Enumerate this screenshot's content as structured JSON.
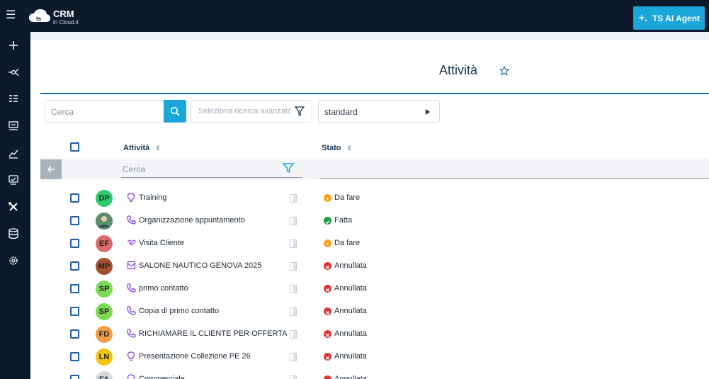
{
  "app": {
    "brand": "CRM",
    "brand_sub": "in Cloud.it",
    "agent_button": "TS AI Agent"
  },
  "page": {
    "title": "Attività"
  },
  "search": {
    "placeholder": "Cerca",
    "advanced_placeholder": "Seleziona ricerca avanzata",
    "view": "standard"
  },
  "table": {
    "headers": {
      "activity": "Attività",
      "status": "Stato"
    },
    "column_search": "Cerca",
    "rows": [
      {
        "initials": "DP",
        "avatar_color": "#2ecc71",
        "icon": "lightbulb-icon",
        "activity": "Training",
        "status": "Da fare",
        "status_color": "#f5a623"
      },
      {
        "initials": "",
        "avatar_color": "#5a8f6e",
        "icon": "phone-icon",
        "activity": "Organizzazione appuntamento",
        "status": "Fatta",
        "status_color": "#1e9e4a"
      },
      {
        "initials": "EF",
        "avatar_color": "#d96b6b",
        "icon": "handshake-icon",
        "activity": "Visita Cliente",
        "status": "Da fare",
        "status_color": "#f5a623"
      },
      {
        "initials": "MP",
        "avatar_color": "#a0522d",
        "icon": "mail-icon",
        "activity": "SALONE NAUTICO GENOVA 2025",
        "status": "Annullata",
        "status_color": "#e0343b"
      },
      {
        "initials": "SP",
        "avatar_color": "#7ed957",
        "icon": "phone-icon",
        "activity": "primo contatto",
        "status": "Annullata",
        "status_color": "#e0343b"
      },
      {
        "initials": "SP",
        "avatar_color": "#7ed957",
        "icon": "phone-icon",
        "activity": "Copia di primo contatto",
        "status": "Annullata",
        "status_color": "#e0343b"
      },
      {
        "initials": "FD",
        "avatar_color": "#f39c4a",
        "icon": "phone-icon",
        "activity": "RICHIAMARE IL CLIENTE PER OFFERTA",
        "status": "Annullata",
        "status_color": "#e0343b"
      },
      {
        "initials": "LN",
        "avatar_color": "#f1c40f",
        "icon": "lightbulb-icon",
        "activity": "Presentazione Collezione PE 26",
        "status": "Annullata",
        "status_color": "#e0343b"
      },
      {
        "initials": "FA",
        "avatar_color": "#d5d8dc",
        "icon": "lightbulb-icon",
        "activity": "Commerciale",
        "status": "Annullata",
        "status_color": "#e0343b"
      }
    ]
  },
  "colors": {
    "topbar": "#0c1a2c",
    "accent": "#1aa6d9",
    "title": "#16374f"
  }
}
